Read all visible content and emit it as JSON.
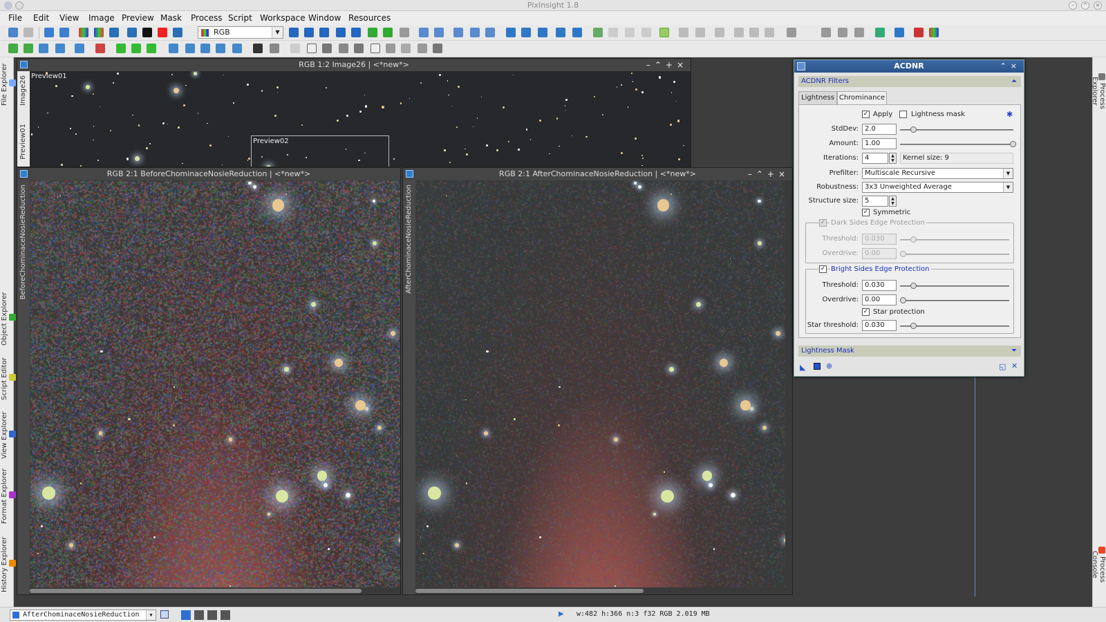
{
  "app": {
    "title": "PixInsight 1.8"
  },
  "menu": [
    "File",
    "Edit",
    "View",
    "Image",
    "Preview",
    "Mask",
    "Process",
    "Script",
    "Workspace",
    "Window",
    "Resources"
  ],
  "toolbar": {
    "color_mode": "RGB"
  },
  "left_dock": {
    "tabs": [
      "File Explorer",
      "Object Explorer",
      "Script Editor",
      "View Explorer",
      "Format Explorer",
      "History Explorer"
    ]
  },
  "right_dock": {
    "tabs": [
      "Process Explorer",
      "Process Console"
    ]
  },
  "windows": {
    "top": {
      "title": "RGB 1:2 Image26 | <*new*>",
      "side_tabs": [
        "Image26",
        "Preview01"
      ],
      "previews": [
        "Preview01",
        "Preview02"
      ]
    },
    "before": {
      "title": "RGB 2:1 BeforeChominaceNosieReduction | <*new*>",
      "side_label": "BeforeChominaceNosieReduction"
    },
    "after": {
      "title": "RGB 2:1 AfterChominaceNosieReduction | <*new*>",
      "side_label": "AfterChominaceNosieReduction"
    }
  },
  "acdnr": {
    "title": "ACDNR",
    "filters_section": "ACDNR Filters",
    "tabs": [
      "Lightness",
      "Chrominance"
    ],
    "active_tab": "Chrominance",
    "apply_label": "Apply",
    "apply_checked": true,
    "lightness_mask_label": "Lightness mask",
    "lightness_mask_checked": false,
    "stddev_label": "StdDev:",
    "stddev": "2.0",
    "stddev_level": 0.12,
    "amount_label": "Amount:",
    "amount": "1.00",
    "amount_level": 1.0,
    "iterations_label": "Iterations:",
    "iterations": "4",
    "kernel_size": "Kernel size: 9",
    "prefilter_label": "Prefilter:",
    "prefilter": "Multiscale Recursive",
    "robustness_label": "Robustness:",
    "robustness": "3x3 Unweighted Average",
    "structure_label": "Structure size:",
    "structure_size": "5",
    "symmetric_label": "Symmetric",
    "dark_group": {
      "label": "Dark Sides Edge Protection",
      "threshold_label": "Threshold:",
      "threshold": "0.030",
      "overdrive_label": "Overdrive:",
      "overdrive": "0.00"
    },
    "bright_group": {
      "label": "Bright Sides Edge Protection",
      "threshold_label": "Threshold:",
      "threshold": "0.030",
      "overdrive_label": "Overdrive:",
      "overdrive": "0.00",
      "star_protection_label": "Star protection",
      "star_threshold_label": "Star threshold:",
      "star_threshold": "0.030"
    },
    "lightness_mask_section": "Lightness Mask"
  },
  "status": {
    "view": "AfterChominaceNosieReduction",
    "info": "w:482  h:366  n:3  f32  RGB  2.019 MB"
  },
  "colors": {
    "accent": "#2b5389",
    "section_text": "#1b2cc4",
    "workspace": "#3d3d3d"
  }
}
